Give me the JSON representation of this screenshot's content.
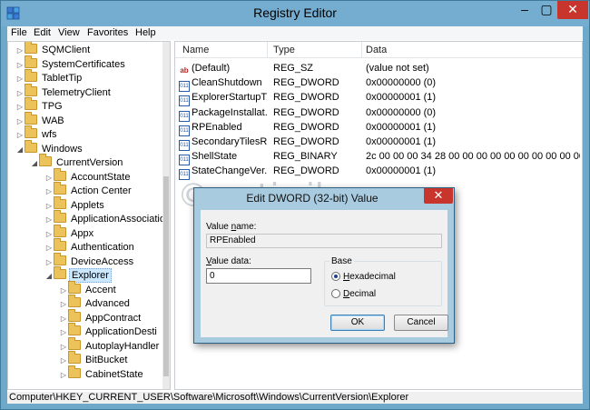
{
  "window": {
    "title": "Registry Editor"
  },
  "menu": [
    "File",
    "Edit",
    "View",
    "Favorites",
    "Help"
  ],
  "tree": {
    "items": [
      {
        "label": "SQMClient",
        "depth": 1,
        "expanded": false
      },
      {
        "label": "SystemCertificates",
        "depth": 1,
        "expanded": false
      },
      {
        "label": "TabletTip",
        "depth": 1,
        "expanded": false
      },
      {
        "label": "TelemetryClient",
        "depth": 1,
        "expanded": false
      },
      {
        "label": "TPG",
        "depth": 1,
        "expanded": false
      },
      {
        "label": "WAB",
        "depth": 1,
        "expanded": false
      },
      {
        "label": "wfs",
        "depth": 1,
        "expanded": false
      },
      {
        "label": "Windows",
        "depth": 1,
        "expanded": true
      },
      {
        "label": "CurrentVersion",
        "depth": 2,
        "expanded": true
      },
      {
        "label": "AccountState",
        "depth": 3,
        "expanded": false
      },
      {
        "label": "Action Center",
        "depth": 3,
        "expanded": false
      },
      {
        "label": "Applets",
        "depth": 3,
        "expanded": false
      },
      {
        "label": "ApplicationAssociatio",
        "depth": 3,
        "expanded": false
      },
      {
        "label": "Appx",
        "depth": 3,
        "expanded": false
      },
      {
        "label": "Authentication",
        "depth": 3,
        "expanded": false
      },
      {
        "label": "DeviceAccess",
        "depth": 3,
        "expanded": false
      },
      {
        "label": "Explorer",
        "depth": 3,
        "expanded": true,
        "selected": true
      },
      {
        "label": "Accent",
        "depth": 4,
        "expanded": false
      },
      {
        "label": "Advanced",
        "depth": 4,
        "expanded": false
      },
      {
        "label": "AppContract",
        "depth": 4,
        "expanded": false
      },
      {
        "label": "ApplicationDesti",
        "depth": 4,
        "expanded": false
      },
      {
        "label": "AutoplayHandler",
        "depth": 4,
        "expanded": false
      },
      {
        "label": "BitBucket",
        "depth": 4,
        "expanded": false
      },
      {
        "label": "CabinetState",
        "depth": 4,
        "expanded": false
      }
    ]
  },
  "list": {
    "columns": [
      "Name",
      "Type",
      "Data"
    ],
    "rows": [
      {
        "icon": "string-value-icon",
        "name": "(Default)",
        "type": "REG_SZ",
        "data": "(value not set)"
      },
      {
        "icon": "dword-value-icon",
        "name": "CleanShutdown",
        "type": "REG_DWORD",
        "data": "0x00000000 (0)"
      },
      {
        "icon": "dword-value-icon",
        "name": "ExplorerStartupT...",
        "type": "REG_DWORD",
        "data": "0x00000001 (1)"
      },
      {
        "icon": "dword-value-icon",
        "name": "PackageInstallat...",
        "type": "REG_DWORD",
        "data": "0x00000000 (0)"
      },
      {
        "icon": "dword-value-icon",
        "name": "RPEnabled",
        "type": "REG_DWORD",
        "data": "0x00000001 (1)"
      },
      {
        "icon": "dword-value-icon",
        "name": "SecondaryTilesR...",
        "type": "REG_DWORD",
        "data": "0x00000001 (1)"
      },
      {
        "icon": "binary-value-icon",
        "name": "ShellState",
        "type": "REG_BINARY",
        "data": "2c 00 00 00 34 28 00 00 00 00 00 00 00 00 00 00 00..."
      },
      {
        "icon": "dword-value-icon",
        "name": "StateChangeVer...",
        "type": "REG_DWORD",
        "data": "0x00000001 (1)"
      }
    ]
  },
  "status_path": "Computer\\HKEY_CURRENT_USER\\Software\\Microsoft\\Windows\\CurrentVersion\\Explorer",
  "watermark": "© setiwik.ru",
  "dialog": {
    "title": "Edit DWORD (32-bit) Value",
    "value_name_label_pre": "Value ",
    "value_name_label_u": "n",
    "value_name_label_post": "ame:",
    "value_name": "RPEnabled",
    "value_data_label_u": "V",
    "value_data_label_post": "alue data:",
    "value_data": "0",
    "base_label": "Base",
    "hex_u": "H",
    "hex_post": "exadecimal",
    "dec_u": "D",
    "dec_post": "ecimal",
    "base_selected": "Hexadecimal",
    "ok_label": "OK",
    "cancel_label": "Cancel"
  }
}
